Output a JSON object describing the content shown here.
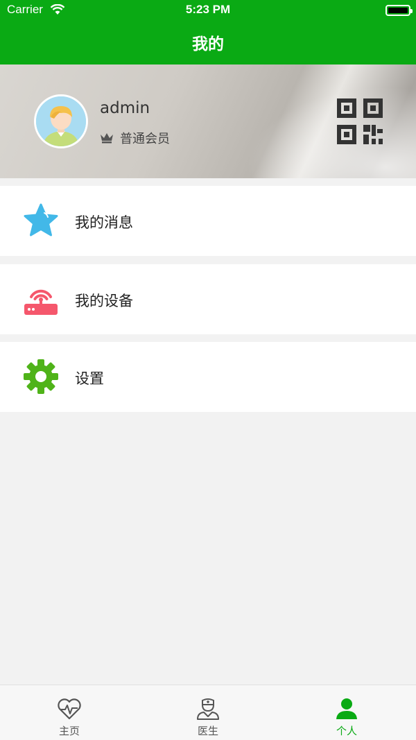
{
  "status_bar": {
    "carrier": "Carrier",
    "time": "5:23 PM"
  },
  "header": {
    "title": "我的"
  },
  "profile": {
    "username": "admin",
    "member_level": "普通会员"
  },
  "menu": [
    {
      "label": "我的消息",
      "icon": "star-icon",
      "color": "#42b8e8"
    },
    {
      "label": "我的设备",
      "icon": "router-icon",
      "color": "#f5576c"
    },
    {
      "label": "设置",
      "icon": "gear-icon",
      "color": "#4fb319"
    }
  ],
  "tabbar": [
    {
      "label": "主页",
      "icon": "heart-pulse-icon",
      "active": false
    },
    {
      "label": "医生",
      "icon": "doctor-icon",
      "active": false
    },
    {
      "label": "个人",
      "icon": "person-icon",
      "active": true
    }
  ],
  "colors": {
    "primary": "#0aaa14",
    "background": "#f2f2f2"
  }
}
